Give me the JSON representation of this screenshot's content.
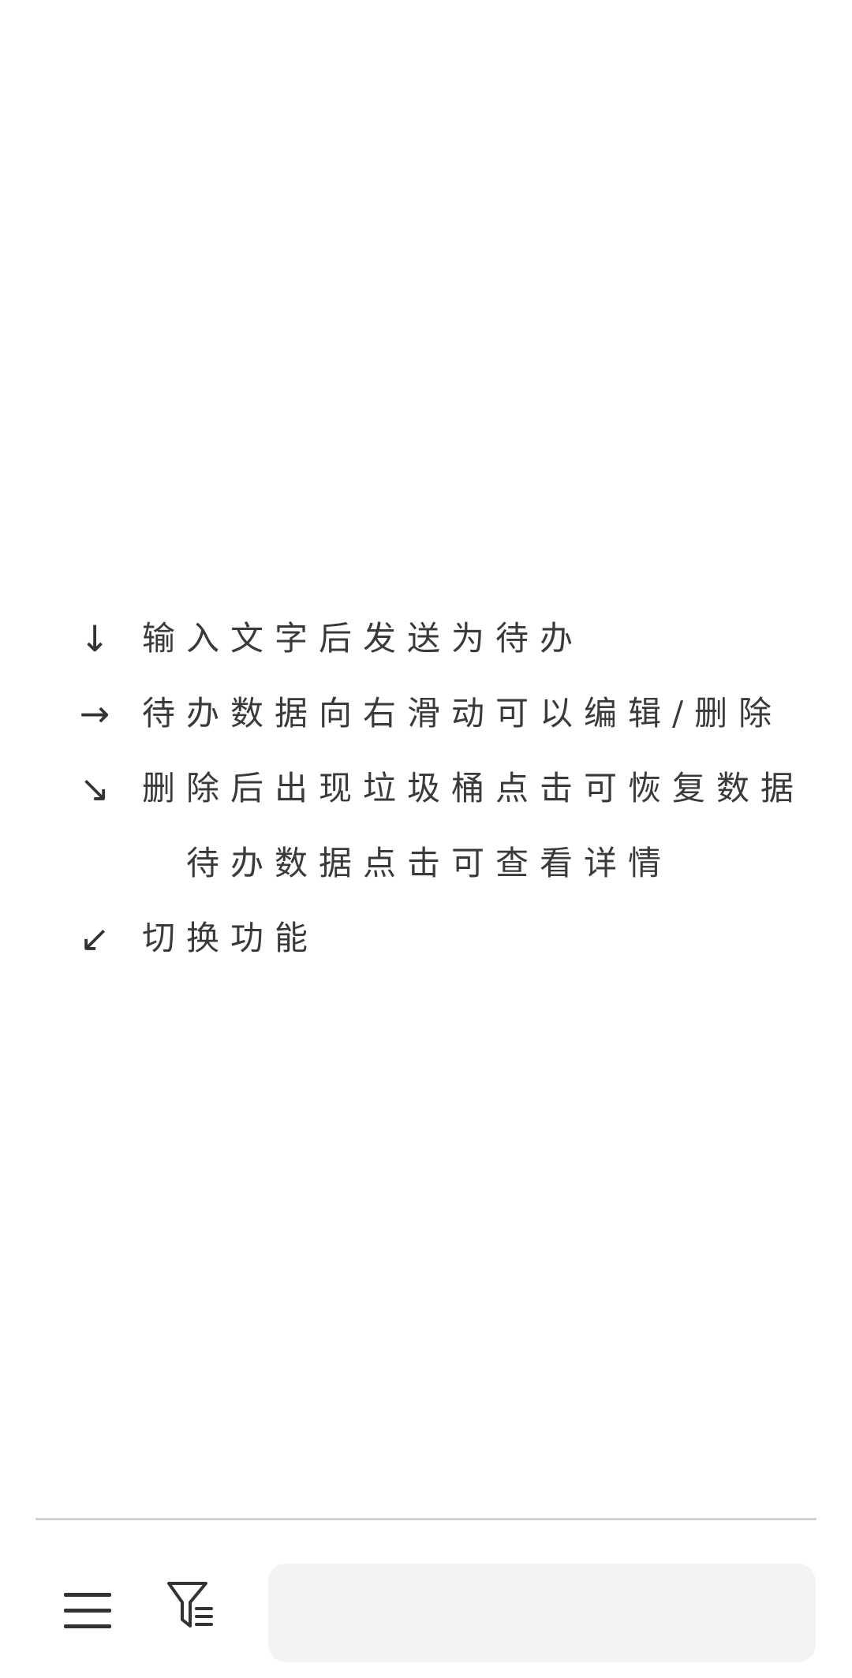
{
  "hints": [
    {
      "arrow": "↓",
      "arrow_icon": "arrow-down-icon",
      "text": "输入文字后发送为待办"
    },
    {
      "arrow": "→",
      "arrow_icon": "arrow-right-icon",
      "text": "待办数据向右滑动可以编辑/删除"
    },
    {
      "arrow": "↘",
      "arrow_icon": "arrow-down-right-icon",
      "text": "删除后出现垃圾桶点击可恢复数据"
    },
    {
      "arrow": "",
      "arrow_icon": "",
      "text": "待办数据点击可查看详情"
    },
    {
      "arrow": "↙",
      "arrow_icon": "arrow-down-left-icon",
      "text": "切换功能"
    }
  ],
  "bottom_bar": {
    "menu_icon": "menu-icon",
    "filter_icon": "filter-list-icon",
    "input_value": "",
    "input_placeholder": ""
  },
  "colors": {
    "text": "#333333",
    "divider": "#cfcfcf",
    "input_background": "#f3f3f3",
    "background": "#ffffff"
  }
}
